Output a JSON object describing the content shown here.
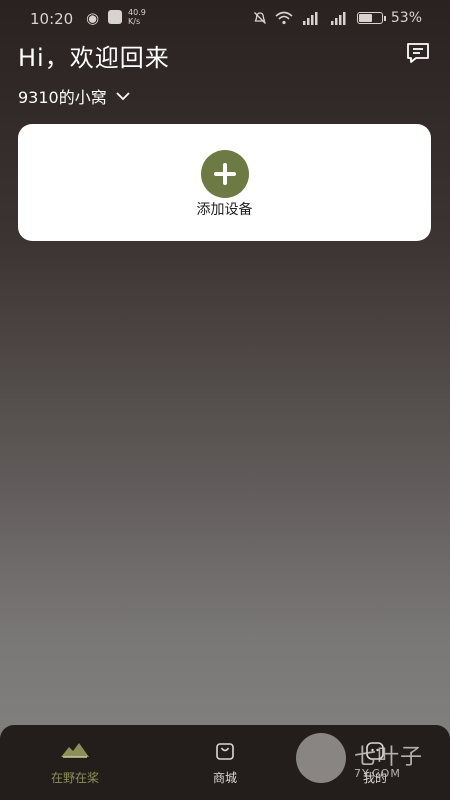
{
  "status_bar": {
    "time": "10:20",
    "speed_top": "40.9",
    "speed_bottom": "K/s",
    "battery_percent": "53%",
    "battery_level": 0.53,
    "icons": [
      "eye-icon",
      "app-badge-icon",
      "mute-icon",
      "wifi-icon",
      "signal-icon",
      "signal-icon-2",
      "battery-icon"
    ]
  },
  "header": {
    "greeting": "Hi，欢迎回来",
    "home_name": "9310的小窝"
  },
  "add_device": {
    "label": "添加设备"
  },
  "tabbar": {
    "tabs": [
      {
        "label": "在野在桨",
        "icon": "mountain-icon",
        "active": true
      },
      {
        "label": "商城",
        "icon": "shopping-bag-icon",
        "active": false
      },
      {
        "label": "我的",
        "icon": "profile-icon",
        "active": false
      }
    ]
  },
  "watermark": {
    "title": "七叶子",
    "subtitle": "7Y.COM"
  },
  "colors": {
    "accent": "#6e7a43",
    "active_tab": "#8a9058",
    "tabbar_bg": "#231e1c",
    "card_bg": "#ffffff"
  }
}
